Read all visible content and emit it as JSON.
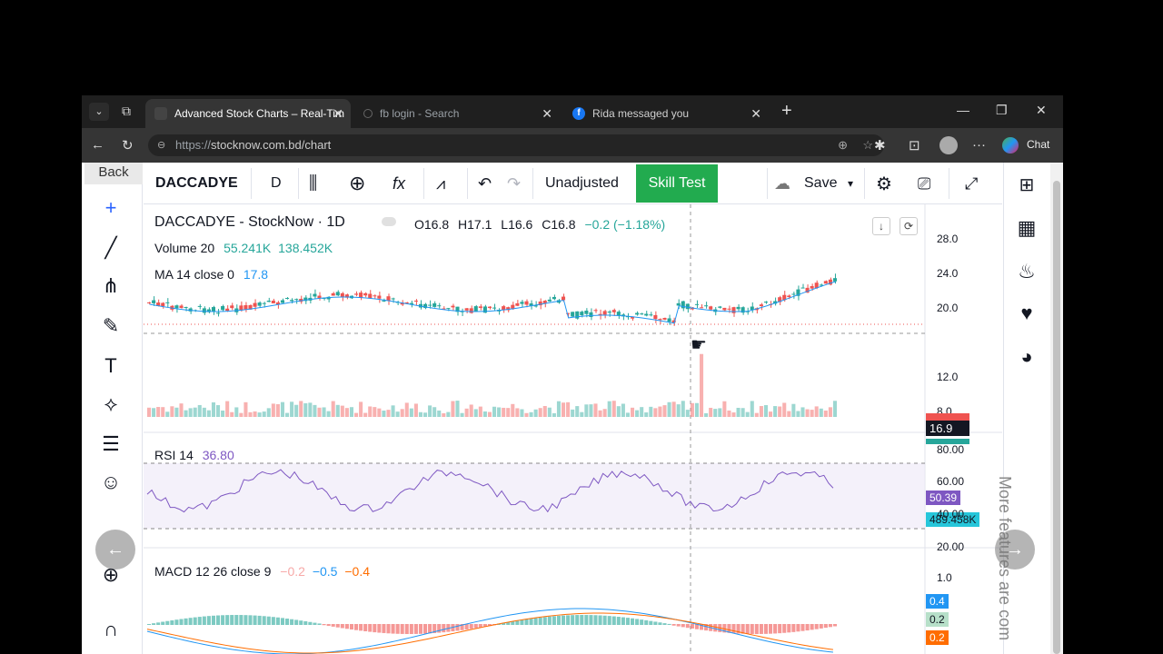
{
  "browser": {
    "tabs": [
      {
        "title": "Advanced Stock Charts – Real-Tim"
      },
      {
        "title": "fb login - Search"
      },
      {
        "title": "Rida messaged you"
      }
    ],
    "url_proto": "https://",
    "url_host": "stocknow.com.bd/chart",
    "chat_label": "Chat"
  },
  "sidebar": {
    "back_label": "Back"
  },
  "toolbar": {
    "symbol": "DACCADYE",
    "interval": "D",
    "adjust": "Unadjusted",
    "skill_test": "Skill Test",
    "save": "Save"
  },
  "legend": {
    "title": "DACCADYE - StockNow · 1D",
    "open": "O16.8",
    "high": "H17.1",
    "low": "L16.6",
    "close": "C16.8",
    "change": "−0.2 (−1.18%)",
    "volume_name": "Volume 20",
    "volume_v1": "55.241K",
    "volume_v2": "138.452K",
    "ma_name": "MA 14 close 0",
    "ma_value": "17.8",
    "rsi_name": "RSI 14",
    "rsi_value": "36.80",
    "macd_name": "MACD 12 26 close 9",
    "macd_v1": "−0.2",
    "macd_v2": "−0.5",
    "macd_v3": "−0.4"
  },
  "axes": {
    "price": [
      "28.0",
      "24.0",
      "20.0",
      "12.0",
      "8.0"
    ],
    "price_tag": "16.9",
    "volume_tag": "489.458K",
    "rsi": [
      "80.00",
      "60.00",
      "40.00",
      "20.00"
    ],
    "rsi_tag": "50.39",
    "macd": [
      "1.0"
    ],
    "macd_tags": [
      "0.4",
      "0.2",
      "0.2"
    ]
  },
  "side_text": "More features are com",
  "colors": {
    "up": "#26a69a",
    "down": "#ef5350",
    "ma": "#2196f3",
    "rsi": "#7e57c2",
    "skill": "#22ab4f"
  }
}
